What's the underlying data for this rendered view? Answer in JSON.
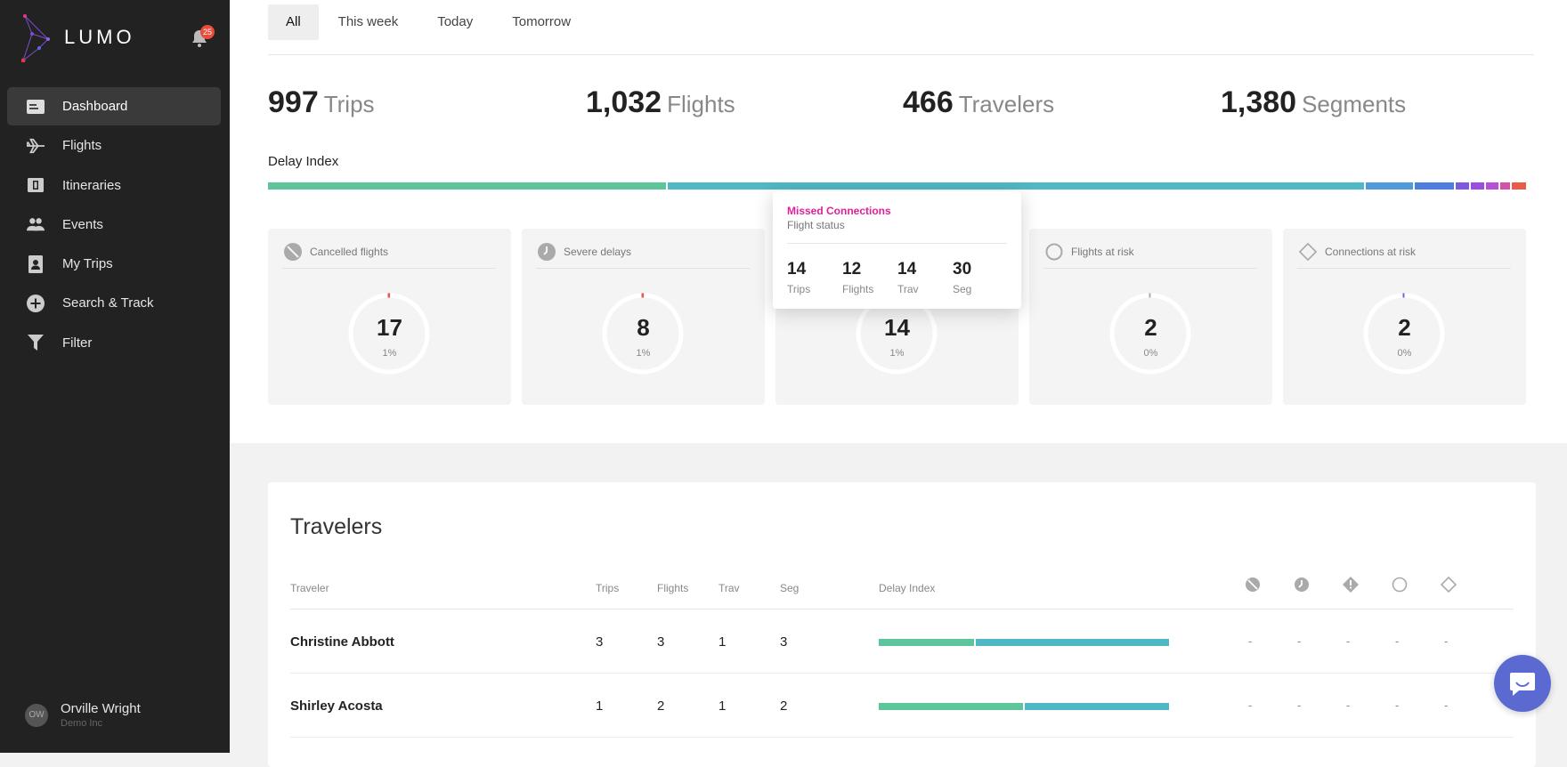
{
  "sidebar": {
    "brand": "LUMO",
    "notifications": "25",
    "items": [
      {
        "label": "Dashboard",
        "icon": "dashboard-icon",
        "active": true
      },
      {
        "label": "Flights",
        "icon": "plane-icon",
        "active": false
      },
      {
        "label": "Itineraries",
        "icon": "itinerary-icon",
        "active": false
      },
      {
        "label": "Events",
        "icon": "users-icon",
        "active": false
      },
      {
        "label": "My Trips",
        "icon": "trips-icon",
        "active": false
      },
      {
        "label": "Search & Track",
        "icon": "plus-circle-icon",
        "active": false
      },
      {
        "label": "Filter",
        "icon": "filter-icon",
        "active": false
      }
    ],
    "user": {
      "initials": "OW",
      "name": "Orville Wright",
      "org": "Demo Inc"
    }
  },
  "tabs": [
    "All",
    "This week",
    "Today",
    "Tomorrow"
  ],
  "stats": [
    {
      "value": "997",
      "label": "Trips"
    },
    {
      "value": "1,032",
      "label": "Flights"
    },
    {
      "value": "466",
      "label": "Travelers"
    },
    {
      "value": "1,380",
      "label": "Segments"
    }
  ],
  "delay_index": {
    "label": "Delay Index",
    "segments": [
      {
        "fraction": 0.316,
        "color": "#5cc59a"
      },
      {
        "fraction": 0.551,
        "color": "#4fb8c4"
      },
      {
        "fraction": 0.039,
        "color": "#4d9bdb"
      },
      {
        "fraction": 0.032,
        "color": "#4a7fe0"
      },
      {
        "fraction": 0.012,
        "color": "#7d5be0"
      },
      {
        "fraction": 0.012,
        "color": "#9a4fe0"
      },
      {
        "fraction": 0.011,
        "color": "#b84fd6"
      },
      {
        "fraction": 0.009,
        "color": "#d64fa8"
      },
      {
        "fraction": 0.013,
        "color": "#e85b4a"
      }
    ]
  },
  "cards": [
    {
      "label": "Cancelled flights",
      "icon": "cancelled-icon",
      "value": "17",
      "pct": "1%",
      "fraction": 0.01,
      "color": "#e85b4a"
    },
    {
      "label": "Severe delays",
      "icon": "clock-icon",
      "value": "8",
      "pct": "1%",
      "fraction": 0.01,
      "color": "#e85b4a"
    },
    {
      "label": "",
      "icon": "",
      "value": "14",
      "pct": "1%",
      "fraction": 0.01,
      "color": "#b84fd6"
    },
    {
      "label": "Flights at risk",
      "icon": "circle-icon",
      "value": "2",
      "pct": "0%",
      "fraction": 0.002,
      "color": "#aaaaaa"
    },
    {
      "label": "Connections at risk",
      "icon": "diamond-icon",
      "value": "2",
      "pct": "0%",
      "fraction": 0.002,
      "color": "#7d5be0"
    }
  ],
  "popup": {
    "title": "Missed Connections",
    "subtitle": "Flight status",
    "stats": [
      {
        "value": "14",
        "label": "Trips"
      },
      {
        "value": "12",
        "label": "Flights"
      },
      {
        "value": "14",
        "label": "Trav"
      },
      {
        "value": "30",
        "label": "Seg"
      }
    ]
  },
  "travelers": {
    "title": "Travelers",
    "columns": {
      "traveler": "Traveler",
      "trips": "Trips",
      "flights": "Flights",
      "trav": "Trav",
      "seg": "Seg",
      "delay": "Delay Index"
    },
    "status_icons": [
      "cancelled-icon",
      "clock-icon",
      "warning-diamond-icon",
      "circle-icon",
      "diamond-icon"
    ],
    "rows": [
      {
        "name": "Christine Abbott",
        "trips": "3",
        "flights": "3",
        "trav": "1",
        "seg": "3",
        "bar": [
          {
            "fraction": 0.33,
            "color": "#5cc59a"
          },
          {
            "fraction": 0.67,
            "color": "#4fb8c4"
          }
        ],
        "status": [
          "-",
          "-",
          "-",
          "-",
          "-"
        ]
      },
      {
        "name": "Shirley Acosta",
        "trips": "1",
        "flights": "2",
        "trav": "1",
        "seg": "2",
        "bar": [
          {
            "fraction": 0.5,
            "color": "#5cc59a"
          },
          {
            "fraction": 0.5,
            "color": "#4fb8c4"
          }
        ],
        "status": [
          "-",
          "-",
          "-",
          "-",
          "-"
        ]
      }
    ]
  }
}
